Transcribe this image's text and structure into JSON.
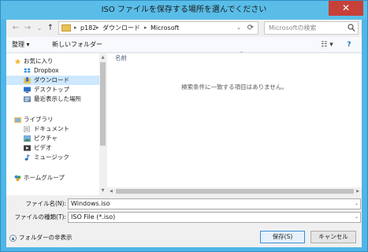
{
  "window": {
    "title": "ISO ファイルを保存する場所を選んでください",
    "close_glyph": "✕"
  },
  "nav": {
    "back_glyph": "←",
    "forward_glyph": "→",
    "recent_glyph": "⌄",
    "up_glyph": "↑",
    "breadcrumbs": [
      "p182",
      "ダウンロード",
      "Microsoft"
    ],
    "crumb_sep_glyph": "▸",
    "dropdown_glyph": "⌄",
    "refresh_glyph": "⟳",
    "search_placeholder": "Microsoftの検索"
  },
  "toolbar": {
    "organize_label": "整理 ▾",
    "new_folder_label": "新しいフォルダー",
    "view_glyph": "☷ ▾",
    "help_glyph": "?"
  },
  "sidebar": {
    "favorites_label": "お気に入り",
    "favorites": [
      {
        "label": "Dropbox",
        "icon": "dropbox-icon"
      },
      {
        "label": "ダウンロード",
        "icon": "downloads-folder-icon"
      },
      {
        "label": "デスクトップ",
        "icon": "desktop-icon"
      },
      {
        "label": "最近表示した場所",
        "icon": "recent-places-icon"
      }
    ],
    "libraries_label": "ライブラリ",
    "libraries": [
      {
        "label": "ドキュメント",
        "icon": "documents-icon"
      },
      {
        "label": "ピクチャ",
        "icon": "pictures-icon"
      },
      {
        "label": "ビデオ",
        "icon": "videos-icon"
      },
      {
        "label": "ミュージック",
        "icon": "music-icon"
      }
    ],
    "homegroup_label": "ホームグループ"
  },
  "content": {
    "column_name": "名前",
    "sort_glyph": "^",
    "empty_message": "検索条件に一致する項目はありません。"
  },
  "fields": {
    "filename_label": "ファイル名(N):",
    "filename_value": "Windows.iso",
    "filetype_label": "ファイルの種類(T):",
    "filetype_value": "ISO File (*.iso)",
    "dropdown_glyph": "⌄"
  },
  "footer": {
    "hide_folders_label": "フォルダーの非表示",
    "hide_glyph": "▲",
    "save_label": "保存(S)",
    "cancel_label": "キャンセル"
  },
  "colors": {
    "title_bar": "#59bde8",
    "close_button": "#c7403a",
    "selected_item": "#cde8ff"
  }
}
